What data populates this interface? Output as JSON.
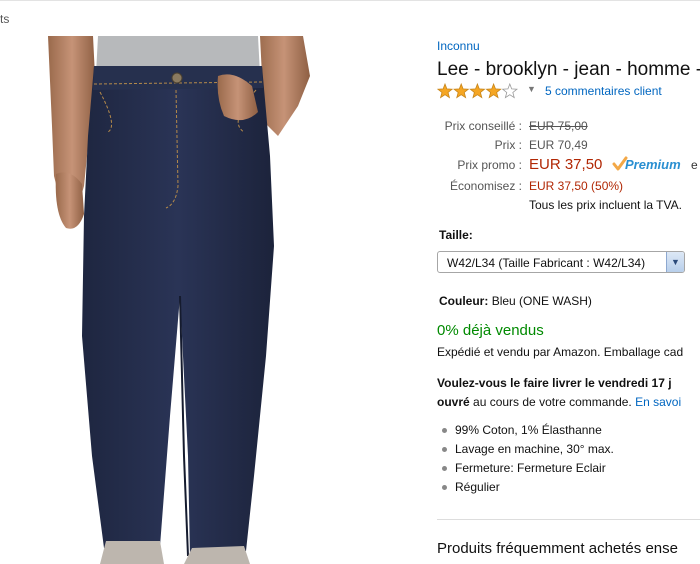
{
  "breadcrumb": {
    "tail": "ts"
  },
  "product": {
    "brand": "Inconnu",
    "title": "Lee - brooklyn - jean - homme -",
    "rating": 4,
    "rating_max": 5,
    "reviews_link": "5 commentaires client"
  },
  "pricing": {
    "list_label": "Prix conseillé :",
    "list_value": "EUR 75,00",
    "price_label": "Prix :",
    "price_value": "EUR 70,49",
    "promo_label": "Prix promo :",
    "promo_value": "EUR 37,50",
    "prime_text": "Premium",
    "prime_trailing": "e",
    "save_label": "Économisez :",
    "save_value": "EUR 37,50 (50%)",
    "vat_note": "Tous les prix incluent la TVA."
  },
  "size": {
    "label": "Taille:",
    "selected": "W42/L34 (Taille Fabricant : W42/L34)"
  },
  "color": {
    "label": "Couleur:",
    "value": "Bleu (ONE WASH)"
  },
  "availability": {
    "sold": "0% déjà vendus",
    "shipped": "Expédié et vendu par Amazon. Emballage cad"
  },
  "delivery": {
    "line1": "Voulez-vous le faire livrer le vendredi 17 j",
    "line2_bold": "ouvré",
    "line2_text": " au cours de votre commande. ",
    "line2_link": "En savoi"
  },
  "features": [
    "99% Coton, 1% Élasthanne",
    "Lavage en machine, 30° max.",
    "Fermeture: Fermeture Eclair",
    "Régulier"
  ],
  "frequently_bought": "Produits fréquemment achetés ense",
  "colors": {
    "link": "#0066c0",
    "price_red": "#b12704",
    "availability_green": "#008a00",
    "star": "#f5a623",
    "denim": "#232c48"
  }
}
